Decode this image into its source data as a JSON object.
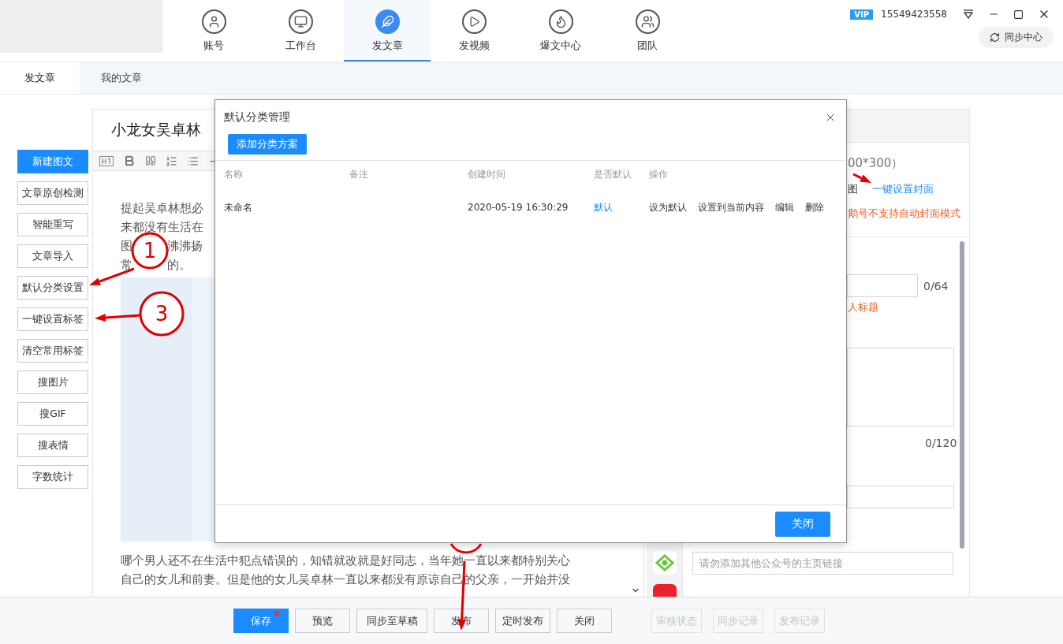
{
  "account": {
    "badge": "VIP",
    "phone": "15549423558"
  },
  "nav": [
    {
      "label": "账号",
      "selected": false
    },
    {
      "label": "工作台",
      "selected": false
    },
    {
      "label": "发文章",
      "selected": true
    },
    {
      "label": "发视频",
      "selected": false
    },
    {
      "label": "爆文中心",
      "selected": false
    },
    {
      "label": "团队",
      "selected": false
    }
  ],
  "sync_button": "同步中心",
  "sub_tabs": [
    {
      "label": "发文章",
      "selected": true
    },
    {
      "label": "我的文章",
      "selected": false
    }
  ],
  "sidebar": [
    {
      "label": "新建图文",
      "kind": "primary"
    },
    {
      "label": "文章原创检测",
      "kind": "default"
    },
    {
      "label": "智能重写",
      "kind": "default"
    },
    {
      "label": "文章导入",
      "kind": "default"
    },
    {
      "label": "默认分类设置",
      "kind": "default"
    },
    {
      "label": "一键设置标签",
      "kind": "default"
    },
    {
      "label": "清空常用标签",
      "kind": "default"
    },
    {
      "label": "搜图片",
      "kind": "default"
    },
    {
      "label": "搜GIF",
      "kind": "default"
    },
    {
      "label": "搜表情",
      "kind": "default"
    },
    {
      "label": "字数统计",
      "kind": "default"
    }
  ],
  "editor": {
    "title": "小龙女吴卓林",
    "lines_top": [
      {
        "text": "提起吴卓林想必"
      },
      {
        "text": "来都没有生活在"
      },
      {
        "left": "图",
        "right": "沸沸扬"
      },
      {
        "left": "常",
        "right": "的。"
      }
    ],
    "lines_bottom": [
      "哪个男人还不在生活中犯点错误的，知错就改就是好同志，当年她一直以来都特别关心",
      "自己的女儿和前妻。但是他的女儿吴卓林一直以来都没有原谅自己的父亲，一开始并没"
    ]
  },
  "right_panel": {
    "size_hint": "00*300）",
    "cover_label": "图",
    "cover_link": "一键设置封面",
    "cover_warning": "鹅号不支持自动封面模式",
    "title_count": "0/64",
    "title_hint": "人标题",
    "summary_count": "0/120",
    "link_placeholder": "请勿添加其他公众号的主页链接"
  },
  "dialog": {
    "title": "默认分类管理",
    "add_button": "添加分类方案",
    "columns": [
      "名称",
      "备注",
      "创建时间",
      "是否默认",
      "操作"
    ],
    "rows": [
      {
        "name": "未命名",
        "created": "2020-05-19 16:30:29",
        "default": "默认",
        "actions": [
          "设为默认",
          "设置到当前内容",
          "编辑",
          "删除"
        ]
      }
    ],
    "close_button": "关闭"
  },
  "bottom_buttons": [
    {
      "label": "保存",
      "kind": "primary",
      "dot": true
    },
    {
      "label": "预览",
      "kind": "default",
      "dot": false
    },
    {
      "label": "同步至草稿",
      "kind": "default",
      "dot": false
    },
    {
      "label": "发布",
      "kind": "default",
      "dot": false
    },
    {
      "label": "定时发布",
      "kind": "default",
      "dot": false
    },
    {
      "label": "关闭",
      "kind": "default",
      "dot": false
    }
  ],
  "record_buttons": [
    {
      "label": "审核状态",
      "disabled": true
    },
    {
      "label": "同步记录",
      "disabled": true
    },
    {
      "label": "发布记录",
      "disabled": true
    }
  ],
  "annotations": [
    {
      "number": "1"
    },
    {
      "number": "3"
    }
  ]
}
